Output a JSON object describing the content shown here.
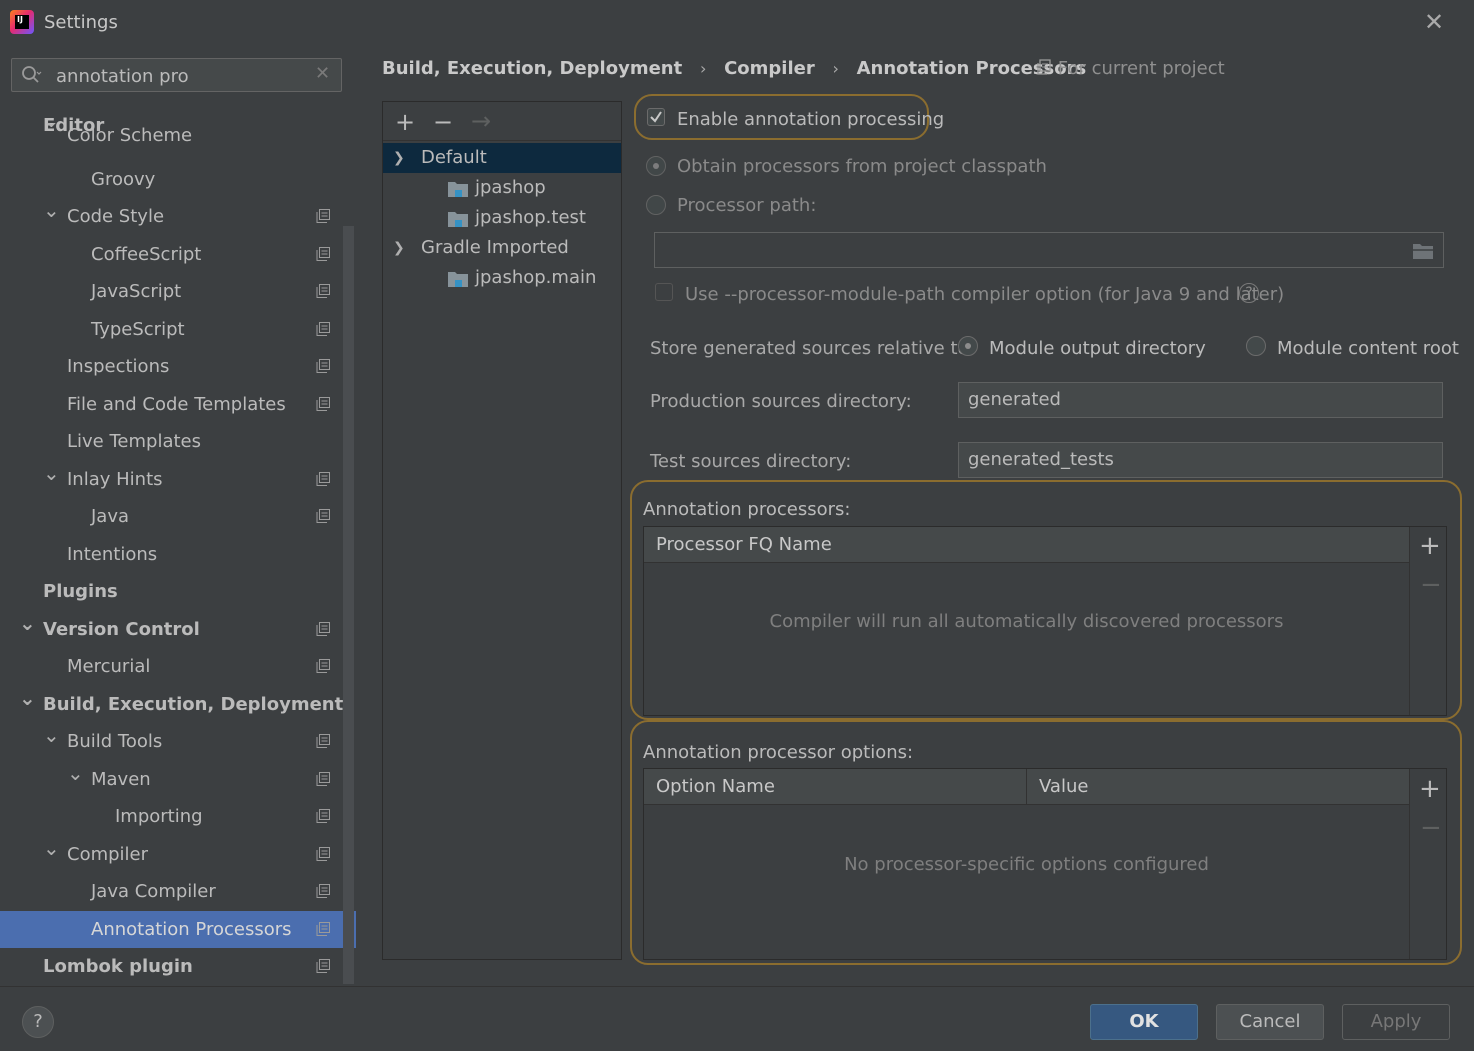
{
  "window": {
    "title": "Settings"
  },
  "search": {
    "value": "annotation pro"
  },
  "sidebar": {
    "items": [
      {
        "label": "Editor",
        "bold": true
      },
      {
        "label": "Color Scheme"
      },
      {
        "label": "Groovy"
      },
      {
        "label": "Code Style"
      },
      {
        "label": "CoffeeScript"
      },
      {
        "label": "JavaScript"
      },
      {
        "label": "TypeScript"
      },
      {
        "label": "Inspections"
      },
      {
        "label": "File and Code Templates"
      },
      {
        "label": "Live Templates"
      },
      {
        "label": "Inlay Hints"
      },
      {
        "label": "Java"
      },
      {
        "label": "Intentions"
      },
      {
        "label": "Plugins",
        "bold": true
      },
      {
        "label": "Version Control",
        "bold": true
      },
      {
        "label": "Mercurial"
      },
      {
        "label": "Build, Execution, Deployment",
        "bold": true
      },
      {
        "label": "Build Tools"
      },
      {
        "label": "Maven"
      },
      {
        "label": "Importing"
      },
      {
        "label": "Compiler"
      },
      {
        "label": "Java Compiler"
      },
      {
        "label": "Annotation Processors",
        "selected": true
      },
      {
        "label": "Lombok plugin",
        "bold": true
      }
    ]
  },
  "breadcrumb": {
    "items": [
      "Build, Execution, Deployment",
      "Compiler",
      "Annotation Processors"
    ],
    "scope": "For current project"
  },
  "modules": {
    "rows": [
      {
        "label": "Default"
      },
      {
        "label": "jpashop"
      },
      {
        "label": "jpashop.test"
      },
      {
        "label": "Gradle Imported"
      },
      {
        "label": "jpashop.main"
      }
    ]
  },
  "settings": {
    "enable_label": "Enable annotation processing",
    "enable_checked": true,
    "obtain_label": "Obtain processors from project classpath",
    "processor_path_label": "Processor path:",
    "processor_path_value": "",
    "module_path_label": "Use --processor-module-path compiler option (for Java 9 and later)",
    "store_label": "Store generated sources relative to:",
    "module_output_label": "Module output directory",
    "module_content_label": "Module content root",
    "prod_label": "Production sources directory:",
    "prod_value": "generated",
    "test_label": "Test sources directory:",
    "test_value": "generated_tests"
  },
  "processors": {
    "title": "Annotation processors:",
    "column": "Processor FQ Name",
    "empty": "Compiler will run all automatically discovered processors"
  },
  "options": {
    "title": "Annotation processor options:",
    "col_name": "Option Name",
    "col_value": "Value",
    "empty": "No processor-specific options configured"
  },
  "footer": {
    "help": "?",
    "ok": "OK",
    "cancel": "Cancel",
    "apply": "Apply"
  }
}
